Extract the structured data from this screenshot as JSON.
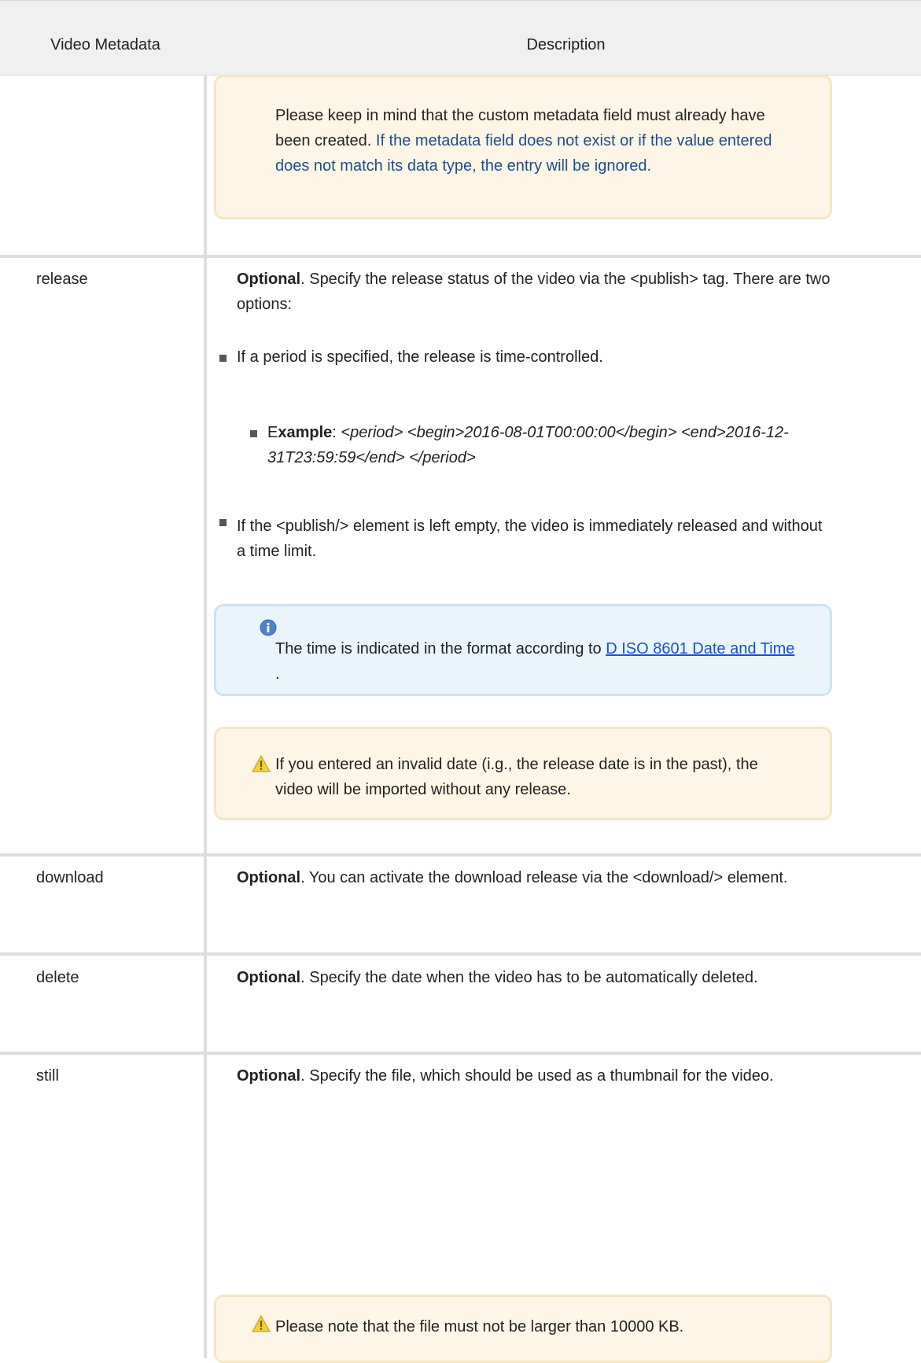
{
  "header": {
    "col1": "Video Metadata",
    "col2": "Description"
  },
  "rows": {
    "custom": {
      "warning_black": "Please keep in mind that the custom metadata field must already have been created.",
      "warning_blue": "If the metadata field does not exist or if the value entered does not match its data type, the entry will be ignored."
    },
    "release": {
      "key": "release",
      "desc_bold": "Optional",
      "desc_rest": ". Specify the release status of the video via the <publish> tag. There are two options:",
      "bullet1": "If a period is specified, the release is time-controlled.",
      "sub_prefix": "E",
      "sub_bold": "xample",
      "sub_colon": ":",
      "sub_code": "<period> <begin>2016-08-01T00:00:00</begin> <end>2016-12-31T23:59:59</end> </period>",
      "bullet2": "If the <publish/> element is left empty, the video is immediately released and without a time limit.",
      "info_text": "The time is indicated in the format according to",
      "info_link": "D ISO 8601 Date and Time ",
      "info_end": ".",
      "warning": "If you entered an invalid date (i.g., the release date is in the past), the video will be imported without any release."
    },
    "download": {
      "key": "download",
      "desc_bold": "Optional",
      "desc_rest": ". You can activate the download release via the <download/> element."
    },
    "delete": {
      "key": "delete",
      "desc_bold": "Optional",
      "desc_rest": ". Specify the date when the video has to be automatically deleted."
    },
    "still": {
      "key": "still",
      "desc_bold": "Optional",
      "desc_rest": ". Specify the file, which should be used as a thumbnail for the video.",
      "warning": "Please note that the file must not be larger than 10000 KB."
    }
  },
  "colors": {
    "warning_bg": "#fdf6e6",
    "info_bg": "#eaf5fb",
    "link": "#1a4fd6",
    "blue_text": "#1e4d8c"
  },
  "icons": {
    "warning": "warning-triangle-icon",
    "info": "info-circle-icon"
  }
}
